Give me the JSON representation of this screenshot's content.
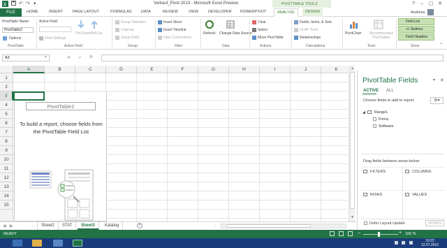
{
  "window": {
    "title": "Verkauf_Pivot 2013 - Microsoft Excel Preview",
    "context_tools": "PIVOTTABLE TOOLS",
    "user": "Andreas",
    "controls": [
      "?",
      "–",
      "▢",
      "✕"
    ]
  },
  "ribbon_tabs": [
    {
      "label": "FILE"
    },
    {
      "label": "HOME"
    },
    {
      "label": "INSERT"
    },
    {
      "label": "PAGE LAYOUT"
    },
    {
      "label": "FORMULAS"
    },
    {
      "label": "DATA"
    },
    {
      "label": "REVIEW"
    },
    {
      "label": "VIEW"
    },
    {
      "label": "DEVELOPER"
    },
    {
      "label": "POWERPIVOT"
    },
    {
      "label": "ANALYZE"
    },
    {
      "label": "DESIGN"
    }
  ],
  "ribbon": {
    "pivottable": {
      "name_label": "PivotTable Name:",
      "name_value": "PivotTable2",
      "options": "Options",
      "group": "PivotTable"
    },
    "active_field": {
      "label": "Active Field:",
      "field_settings": "Field Settings",
      "drill_down": "Drill Down",
      "drill_up": "Drill Up",
      "group": "Active Field"
    },
    "group_grp": {
      "group_selection": "Group Selection",
      "ungroup": "Ungroup",
      "group_field": "Group Field",
      "group": "Group"
    },
    "filter": {
      "insert_slicer": "Insert Slicer",
      "insert_timeline": "Insert Timeline",
      "filter_connections": "Filter Connections",
      "group": "Filter"
    },
    "data": {
      "refresh": "Refresh",
      "change_source": "Change Data Source",
      "group": "Data"
    },
    "actions": {
      "clear": "Clear",
      "select": "Select",
      "move": "Move PivotTable",
      "group": "Actions"
    },
    "calculations": {
      "fields_items": "Fields, Items, & Sets",
      "olap_tools": "OLAP Tools",
      "relationships": "Relationships",
      "group": "Calculations"
    },
    "tools": {
      "pivotchart": "PivotChart",
      "recommended": "Recommended PivotTables",
      "group": "Tools"
    },
    "show": {
      "field_list": "Field List",
      "buttons": "+/- Buttons",
      "headers": "Field Headers",
      "group": "Show"
    }
  },
  "formula_bar": {
    "name_box": "A3",
    "controls": [
      "✕",
      "✓",
      "fx"
    ],
    "value": ""
  },
  "grid": {
    "columns": [
      "A",
      "B",
      "C",
      "D",
      "E",
      "F",
      "G",
      "H",
      "I",
      "J",
      "K"
    ],
    "rows": [
      "1",
      "2",
      "3",
      "4",
      "5",
      "6",
      "7",
      "8",
      "9",
      "10",
      "11",
      "12",
      "13",
      "14",
      "15"
    ],
    "selected_cell": "A3"
  },
  "pivot_placeholder": {
    "name": "PivotTable2",
    "message": "To build a report, choose fields from the PivotTable Field List"
  },
  "sheets": {
    "tabs": [
      "Sheet2",
      "STAT",
      "Sheet3",
      "Katalog"
    ],
    "active": "Sheet3",
    "add": "+"
  },
  "field_pane": {
    "title": "PivotTable Fields",
    "tabs": [
      "ACTIVE",
      "ALL"
    ],
    "choose_label": "Choose fields to add to report:",
    "tree": {
      "root": "Range1",
      "fields": [
        "Firma",
        "Software"
      ]
    },
    "drag_label": "Drag fields between areas below:",
    "areas": [
      "FILTERS",
      "COLUMNS",
      "ROWS",
      "VALUES"
    ],
    "defer_label": "Defer Layout Update",
    "update_button": "UPDATE"
  },
  "status": {
    "ready": "READY",
    "zoom": "100 %"
  },
  "taskbar": {
    "time": "19:22",
    "date": "12.07.2012"
  },
  "colors": {
    "excel_green": "#217346",
    "context_tab_bg": "#e7f0e0",
    "show_button_bg": "#c6e0b4",
    "taskbar": "#1b3c7a"
  }
}
